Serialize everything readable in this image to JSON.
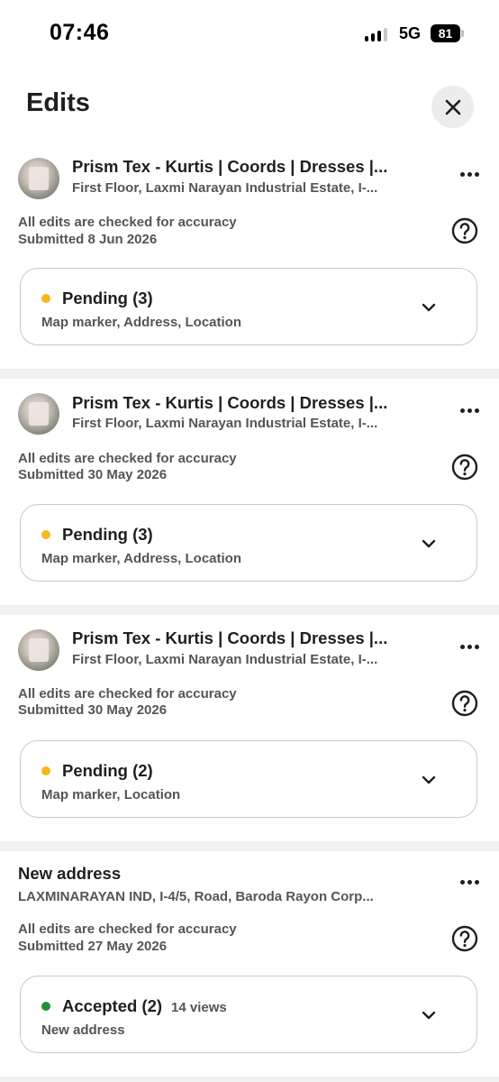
{
  "status_bar": {
    "time": "07:46",
    "network": "5G",
    "battery": "81"
  },
  "header": {
    "title": "Edits"
  },
  "cards": [
    {
      "title": "Prism Tex - Kurtis | Coords | Dresses |...",
      "subtitle": "First Floor, Laxmi Narayan Industrial Estate, I-...",
      "check_note": "All edits are checked for accuracy",
      "submitted": "Submitted 8 Jun 2026",
      "status": "Pending (3)",
      "status_color": "#f6b91a",
      "views": "",
      "items": "Map marker, Address, Location"
    },
    {
      "title": "Prism Tex - Kurtis | Coords | Dresses |...",
      "subtitle": "First Floor, Laxmi Narayan Industrial Estate, I-...",
      "check_note": "All edits are checked for accuracy",
      "submitted": "Submitted 30 May 2026",
      "status": "Pending (3)",
      "status_color": "#f6b91a",
      "views": "",
      "items": "Map marker, Address, Location"
    },
    {
      "title": "Prism Tex - Kurtis | Coords | Dresses |...",
      "subtitle": "First Floor, Laxmi Narayan Industrial Estate, I-...",
      "check_note": "All edits are checked for accuracy",
      "submitted": "Submitted 30 May 2026",
      "status": "Pending (2)",
      "status_color": "#f6b91a",
      "views": "",
      "items": "Map marker, Location"
    },
    {
      "title": "New address",
      "subtitle": "LAXMINARAYAN IND, I-4/5, Road, Baroda Rayon Corp...",
      "check_note": "All edits are checked for accuracy",
      "submitted": "Submitted 27 May 2026",
      "status": "Accepted (2)",
      "status_color": "#1e8e3e",
      "views": "14 views",
      "items": "New address"
    }
  ]
}
